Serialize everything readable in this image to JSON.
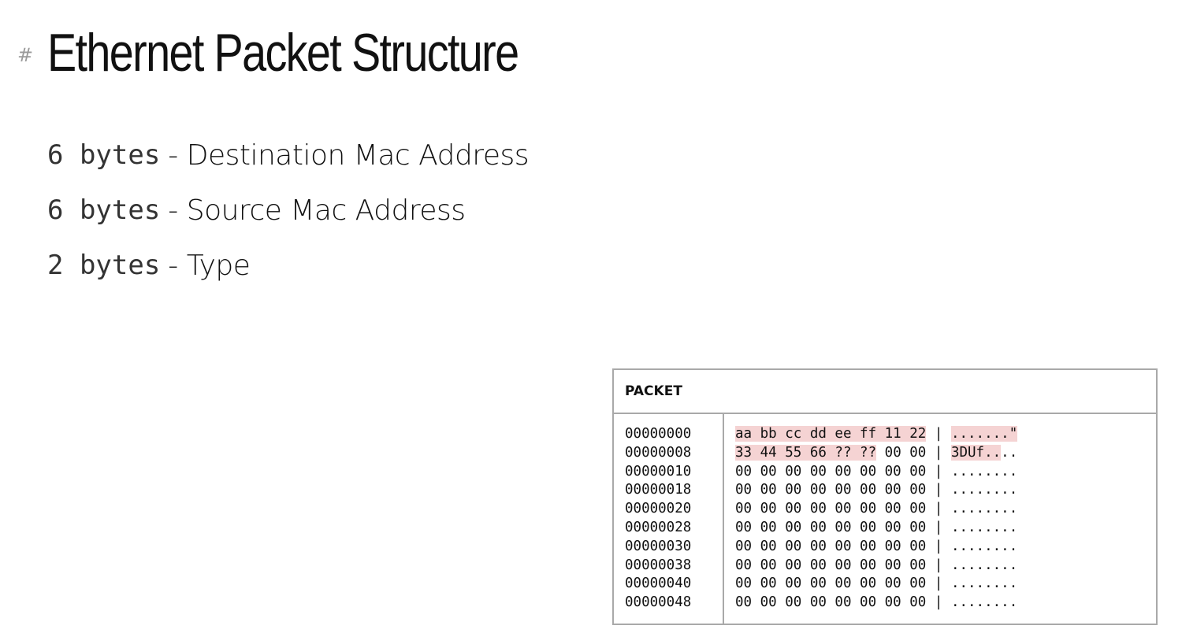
{
  "slide": {
    "hash_marker": "#",
    "title": "Ethernet Packet Structure"
  },
  "fields": [
    {
      "size": "6 bytes",
      "separator": " - ",
      "name": "Destination Mac Address"
    },
    {
      "size": "6 bytes",
      "separator": " - ",
      "name": "Source Mac Address"
    },
    {
      "size": "2 bytes",
      "separator": " - ",
      "name": "Type"
    }
  ],
  "packet": {
    "label": "PACKET",
    "offsets": [
      "00000000",
      "00000008",
      "00000010",
      "00000018",
      "00000020",
      "00000028",
      "00000030",
      "00000038",
      "00000040",
      "00000048"
    ],
    "rows": [
      {
        "hl_hex": "aa bb cc dd ee ff 11 22",
        "hex": "",
        "sep": " | ",
        "hl_ascii": ".......\"",
        "ascii": ""
      },
      {
        "hl_hex": "33 44 55 66 ?? ??",
        "hex": " 00 00",
        "sep": " | ",
        "hl_ascii": "3DUf..",
        "ascii": ".."
      },
      {
        "hl_hex": "",
        "hex": "00 00 00 00 00 00 00 00",
        "sep": " | ",
        "hl_ascii": "",
        "ascii": "........"
      },
      {
        "hl_hex": "",
        "hex": "00 00 00 00 00 00 00 00",
        "sep": " | ",
        "hl_ascii": "",
        "ascii": "........"
      },
      {
        "hl_hex": "",
        "hex": "00 00 00 00 00 00 00 00",
        "sep": " | ",
        "hl_ascii": "",
        "ascii": "........"
      },
      {
        "hl_hex": "",
        "hex": "00 00 00 00 00 00 00 00",
        "sep": " | ",
        "hl_ascii": "",
        "ascii": "........"
      },
      {
        "hl_hex": "",
        "hex": "00 00 00 00 00 00 00 00",
        "sep": " | ",
        "hl_ascii": "",
        "ascii": "........"
      },
      {
        "hl_hex": "",
        "hex": "00 00 00 00 00 00 00 00",
        "sep": " | ",
        "hl_ascii": "",
        "ascii": "........"
      },
      {
        "hl_hex": "",
        "hex": "00 00 00 00 00 00 00 00",
        "sep": " | ",
        "hl_ascii": "",
        "ascii": "........"
      },
      {
        "hl_hex": "",
        "hex": "00 00 00 00 00 00 00 00",
        "sep": " | ",
        "hl_ascii": "",
        "ascii": "........"
      }
    ],
    "highlight_color": "#f5d3d3"
  }
}
